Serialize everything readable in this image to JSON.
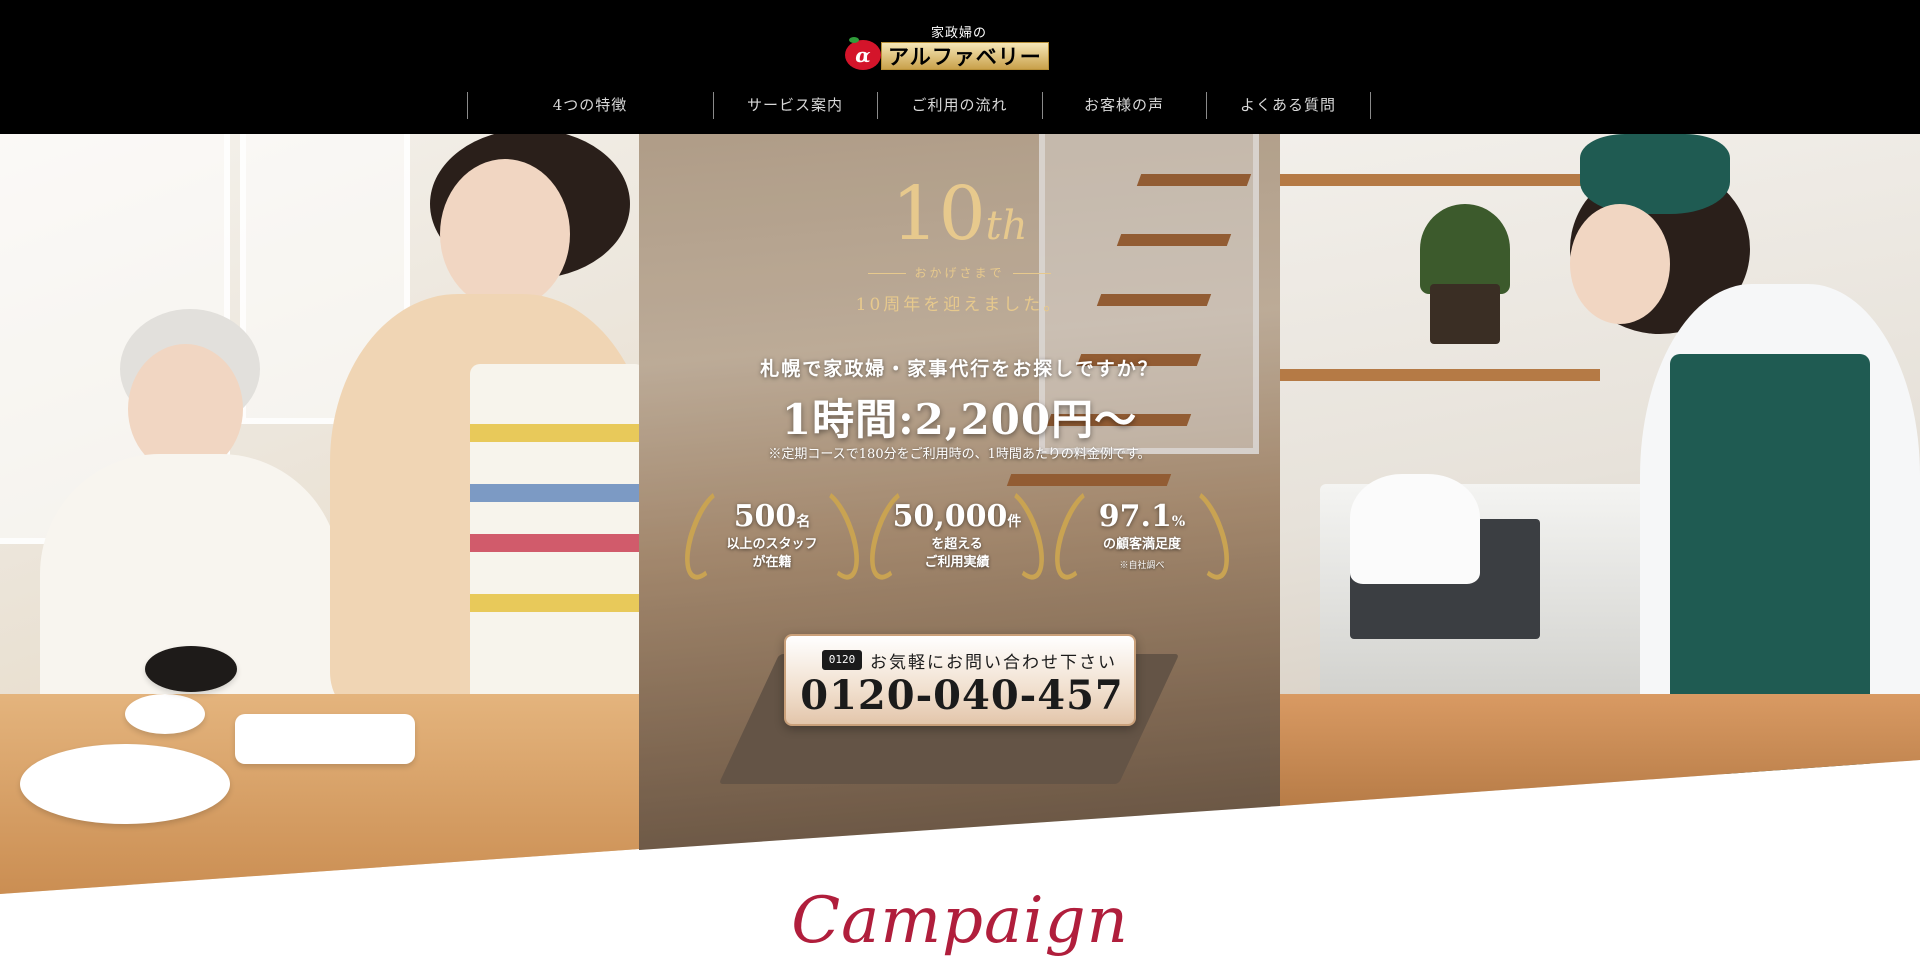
{
  "header": {
    "logo_small": "家政婦の",
    "logo_name": "アルファベリー",
    "logo_mark": "α"
  },
  "nav": {
    "items": [
      {
        "label": "4つの特徴"
      },
      {
        "label": "サービス案内"
      },
      {
        "label": "ご利用の流れ"
      },
      {
        "label": "お客様の声"
      },
      {
        "label": "よくある質問"
      }
    ]
  },
  "hero": {
    "anniversary": {
      "number": "10",
      "suffix": "th",
      "thanks": "おかげさまで",
      "years": "10周年を迎えました。"
    },
    "lead": "札幌で家政婦・家事代行をお探しですか？",
    "price": "1時間:2,200円～",
    "price_note": "※定期コースで180分をご利用時の、1時間あたりの料金例です。",
    "badges": [
      {
        "number": "500",
        "unit": "名",
        "sub": "以上のスタッフ\nが在籍",
        "small": ""
      },
      {
        "number": "50,000",
        "unit": "件",
        "sub": "を超える\nご利用実績",
        "small": ""
      },
      {
        "number": "97.1",
        "unit": "%",
        "sub": "の顧客満足度",
        "small": "※自社調べ"
      }
    ],
    "cta": {
      "free_label": "0120",
      "label": "お気軽にお問い合わせ下さい",
      "tel": "0120-040-457"
    }
  },
  "section": {
    "title": "Campaign"
  },
  "colors": {
    "header_bg": "#000000",
    "accent_gold": "#e7c98d",
    "campaign_red": "#b01e3c"
  }
}
